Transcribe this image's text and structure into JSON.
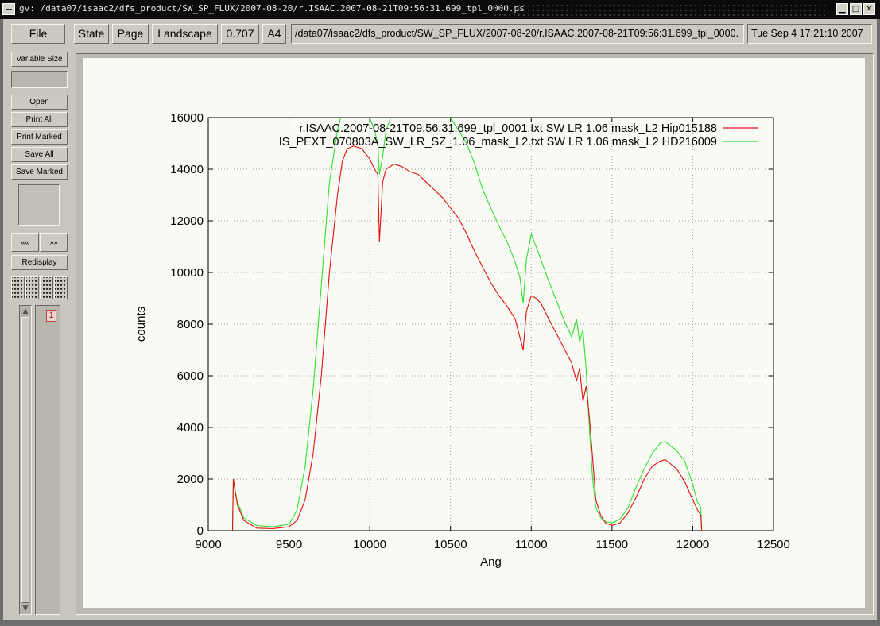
{
  "window": {
    "title": "gv: /data07/isaac2/dfs_product/SW_SP_FLUX/2007-08-20/r.ISAAC.2007-08-21T09:56:31.699_tpl_0000.ps",
    "minimize_icon": "minimize-icon",
    "maximize_icon": "maximize-icon",
    "close_icon": "close-icon"
  },
  "toolbar": {
    "file": "File",
    "state": "State",
    "page": "Page",
    "orientation": "Landscape",
    "scale": "0.707",
    "media": "A4",
    "filename": "/data07/isaac2/dfs_product/SW_SP_FLUX/2007-08-20/r.ISAAC.2007-08-21T09:56:31.699_tpl_0000.",
    "date": "Tue Sep  4 17:21:10 2007"
  },
  "left_panel": {
    "variable_size": "Variable Size",
    "open": "Open",
    "print_all": "Print All",
    "print_marked": "Print Marked",
    "save_all": "Save All",
    "save_marked": "Save Marked",
    "prev": "««",
    "next": "»»",
    "redisplay": "Redisplay",
    "page_number": "1"
  },
  "chart_data": {
    "type": "line",
    "xlabel": "Ang",
    "ylabel": "counts",
    "xlim": [
      9000,
      12500
    ],
    "ylim": [
      0,
      16000
    ],
    "xticks": [
      "9000",
      "9500",
      "10000",
      "10500",
      "11000",
      "11500",
      "12000",
      "12500"
    ],
    "yticks": [
      "0",
      "2000",
      "4000",
      "6000",
      "8000",
      "10000",
      "12000",
      "14000",
      "16000"
    ],
    "grid": true,
    "legend_position": "top-right",
    "series": [
      {
        "name": "r.ISAAC.2007-08-21T09:56:31.699_tpl_0001.txt  SW LR 1.06 mask_L2 Hip015188",
        "color": "#e01010",
        "x": [
          9150,
          9155,
          9180,
          9220,
          9300,
          9400,
          9500,
          9550,
          9600,
          9650,
          9700,
          9750,
          9800,
          9830,
          9860,
          9900,
          9950,
          10000,
          10030,
          10050,
          10060,
          10080,
          10100,
          10150,
          10200,
          10250,
          10300,
          10350,
          10400,
          10450,
          10500,
          10550,
          10600,
          10650,
          10700,
          10750,
          10800,
          10850,
          10900,
          10950,
          10970,
          11000,
          11030,
          11060,
          11100,
          11150,
          11200,
          11250,
          11280,
          11300,
          11320,
          11340,
          11360,
          11380,
          11400,
          11430,
          11460,
          11500,
          11550,
          11600,
          11650,
          11700,
          11750,
          11800,
          11830,
          11860,
          11900,
          11950,
          12000,
          12030,
          12050,
          12055
        ],
        "values": [
          0,
          2000,
          1000,
          400,
          100,
          80,
          150,
          400,
          1200,
          3000,
          6000,
          10000,
          13000,
          14300,
          14800,
          14900,
          14800,
          14400,
          14000,
          13800,
          11200,
          13500,
          14000,
          14200,
          14100,
          13900,
          13800,
          13500,
          13200,
          12900,
          12500,
          12100,
          11500,
          10800,
          10200,
          9600,
          9100,
          8700,
          8200,
          7000,
          8500,
          9100,
          9000,
          8800,
          8300,
          7700,
          7100,
          6500,
          5800,
          6300,
          5000,
          5600,
          4400,
          2800,
          1200,
          600,
          300,
          200,
          300,
          700,
          1300,
          2000,
          2500,
          2700,
          2750,
          2600,
          2400,
          1900,
          1200,
          800,
          600,
          0
        ]
      },
      {
        "name": "IS_PEXT_070803A_SW_LR_SZ_1.06_mask_L2.txt  SW LR 1.06 mask_L2 HD216009",
        "color": "#30e030",
        "x": [
          9150,
          9155,
          9180,
          9220,
          9300,
          9400,
          9500,
          9550,
          9600,
          9650,
          9700,
          9750,
          9800,
          9820,
          9850,
          9900,
          9950,
          10000,
          10030,
          10050,
          10060,
          10080,
          10100,
          10130,
          10200,
          10250,
          10300,
          10350,
          10400,
          10450,
          10500,
          10550,
          10600,
          10650,
          10700,
          10750,
          10800,
          10850,
          10900,
          10930,
          10950,
          10970,
          11000,
          11030,
          11060,
          11100,
          11150,
          11200,
          11250,
          11280,
          11300,
          11320,
          11340,
          11360,
          11380,
          11400,
          11430,
          11460,
          11500,
          11550,
          11600,
          11650,
          11700,
          11750,
          11800,
          11830,
          11860,
          11900,
          11950,
          12000,
          12030,
          12050,
          12055
        ],
        "values": [
          0,
          1900,
          1100,
          500,
          200,
          150,
          250,
          800,
          2500,
          5500,
          9500,
          13500,
          15500,
          16000,
          16000,
          16000,
          16000,
          16000,
          15500,
          15000,
          13800,
          14500,
          15500,
          16000,
          16000,
          16000,
          16000,
          16000,
          16000,
          16000,
          16000,
          15500,
          15000,
          14200,
          13200,
          12500,
          11800,
          11200,
          10400,
          9800,
          8800,
          10500,
          11500,
          11000,
          10500,
          9800,
          9000,
          8200,
          7500,
          8200,
          7300,
          7800,
          6200,
          4000,
          2000,
          900,
          500,
          350,
          300,
          450,
          900,
          1700,
          2400,
          3000,
          3400,
          3450,
          3300,
          3100,
          2700,
          1800,
          1100,
          900,
          0
        ]
      }
    ]
  }
}
